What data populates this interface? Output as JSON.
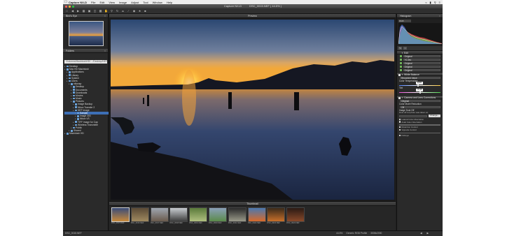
{
  "menubar": {
    "app_name": "Capture NX-D",
    "items": [
      "File",
      "Edit",
      "View",
      "Image",
      "Adjust",
      "Tool",
      "Window",
      "Help"
    ]
  },
  "window": {
    "title": "Capture NX-D",
    "file_title": "DSC_0015.NEF ( 44.5% )"
  },
  "left_panel": {
    "birdseye_title": "Bird's Eye",
    "folders_title": "Folders",
    "folder_path": "/Volumes/MacintoshHD/…/Desktop/NEF Image/Sample",
    "tree": [
      {
        "label": "Desktop",
        "level": 0,
        "selected": false
      },
      {
        "label": "Mac HD Macintosh",
        "level": 0,
        "selected": false
      },
      {
        "label": "Applications",
        "level": 1,
        "selected": false
      },
      {
        "label": "Library",
        "level": 1,
        "selected": false
      },
      {
        "label": "System",
        "level": 1,
        "selected": false
      },
      {
        "label": "Users",
        "level": 1,
        "selected": false
      },
      {
        "label": "nikonsp",
        "level": 2,
        "selected": false
      },
      {
        "label": "Desktop",
        "level": 3,
        "selected": false
      },
      {
        "label": "Documents",
        "level": 3,
        "selected": false
      },
      {
        "label": "Downloads",
        "level": 3,
        "selected": false
      },
      {
        "label": "Movies",
        "level": 3,
        "selected": false
      },
      {
        "label": "Music",
        "level": 3,
        "selected": false
      },
      {
        "label": "Pictures",
        "level": 3,
        "selected": false
      },
      {
        "label": "Image Backup",
        "level": 4,
        "selected": false
      },
      {
        "label": "Nikon Transfer 2",
        "level": 4,
        "selected": false
      },
      {
        "label": "NEF Image",
        "level": 4,
        "selected": false
      },
      {
        "label": "Sample",
        "level": 5,
        "selected": true
      },
      {
        "label": "Image 300",
        "level": 5,
        "selected": false
      },
      {
        "label": "Nikon VS",
        "level": 5,
        "selected": false
      },
      {
        "label": "TIFF Image for Cap",
        "level": 4,
        "selected": false
      },
      {
        "label": "Wireless Transmitte",
        "level": 4,
        "selected": false
      },
      {
        "label": "Public",
        "level": 3,
        "selected": false
      },
      {
        "label": "Shared",
        "level": 2,
        "selected": false
      },
      {
        "label": "Macintosh HD",
        "level": 0,
        "selected": false
      }
    ]
  },
  "preview": {
    "title": "Preview"
  },
  "thumbnails": {
    "title": "Thumbnail",
    "items": [
      {
        "caption": "DSC_0015.NEF",
        "color_a": "#3a4c78",
        "color_b": "#c88a3a",
        "selected": true
      },
      {
        "caption": "DSC_0016.NEF",
        "color_a": "#5a4a36",
        "color_b": "#a08a60",
        "selected": false
      },
      {
        "caption": "DSC_0017.NEF",
        "color_a": "#9ea6b0",
        "color_b": "#6a5a4c",
        "selected": false
      },
      {
        "caption": "DSC_0018.NEF",
        "color_a": "#c8ccd0",
        "color_b": "#3c3c3c",
        "selected": false
      },
      {
        "caption": "DSC_0019.NEF",
        "color_a": "#5a7a3a",
        "color_b": "#b0c080",
        "selected": false
      },
      {
        "caption": "DSC_0020.NEF",
        "color_a": "#8aa0b8",
        "color_b": "#5a8a4a",
        "selected": false
      },
      {
        "caption": "DSC_0021.NEF",
        "color_a": "#2a2a2a",
        "color_b": "#9a9a8a",
        "selected": false
      },
      {
        "caption": "DSC_0022.NEF",
        "color_a": "#4a78b0",
        "color_b": "#d86a2a",
        "selected": false
      },
      {
        "caption": "DSC_0023.NEF",
        "color_a": "#3a2a1a",
        "color_b": "#c8702a",
        "selected": false
      },
      {
        "caption": "DSC_0024.NEF",
        "color_a": "#2a1a14",
        "color_b": "#8a4a2a",
        "selected": false
      }
    ]
  },
  "right_panel": {
    "histogram_title": "Histogram",
    "histogram_channel": "RGB",
    "edit_title": "Edit",
    "steps": [
      "Original",
      "+0.3ev",
      "Original",
      "Original",
      "Original"
    ],
    "white_balance": {
      "title": "White Balance",
      "mode": "Recorded Value",
      "temp_label": "Color Temperature",
      "temp_value": "5000",
      "temp_level": 0.45,
      "tint_label": "Tint",
      "tint_value": "-0.45",
      "tint_level": 0.5
    },
    "lens": {
      "title": "Camera and Lens Corrections",
      "mode": "Original",
      "moire_label": "Color Moiré Reduction",
      "moire_value": "Off",
      "dust_label": "Image Dust Off",
      "dust_text": "Dust off ref photo was taken at:",
      "change_button": "Change...",
      "lateral_label": "Lateral Color Aberration",
      "axial_label": "Axial Color Aberration",
      "distortion_label": "Distortion Control",
      "vignette_label": "Vignette Control",
      "fisheye_label": "Fisheye"
    }
  },
  "status": {
    "left_text": "DSC_0015.NEF",
    "zoom": "44.5%",
    "profile": "Generic RGB Profile",
    "dimensions": "3008x2000"
  },
  "colors": {
    "accent": "#3d6fb6",
    "panel_bg": "#2a2a2a",
    "menubar_bg": "#ececec"
  }
}
